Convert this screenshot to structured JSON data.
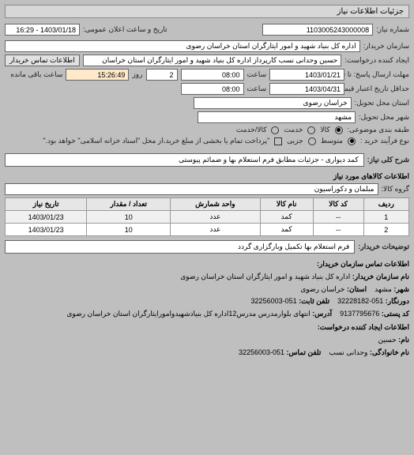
{
  "title": "جزئیات اطلاعات نیاز",
  "header": {
    "need_no_label": "شماره نیاز:",
    "need_no": "1103005243000008",
    "announce_label": "تاریخ و ساعت اعلان عمومی:",
    "announce_date": "1403/01/18 - 16:29",
    "buyer_label": "سازمان خریدار:",
    "buyer": "اداره کل بنیاد شهید و امور ایثارگران استان خراسان رضوی",
    "requester_label": "ایجاد کننده درخواست:",
    "requester": "حسین وحدانی نسب کارپرداز اداره کل بنیاد شهید و امور ایثارگران استان خراسان",
    "contact_btn": "اطلاعات تماس خریدار",
    "deadline_label": "مهلت ارسال پاسخ: تا تاریخ:",
    "deadline_date": "1403/01/21",
    "time_label": "ساعت",
    "deadline_time": "08:00",
    "days_left": "2",
    "days_left_label": "روز",
    "remaining_time": "15:26:49",
    "remaining_label": "ساعت باقی مانده",
    "validity_label": "حداقل تاریخ اعتبار قیمت: تا تاریخ:",
    "validity_date": "1403/04/31",
    "validity_time": "08:00",
    "province_label": "استان محل تحویل:",
    "province": "خراسان رضوی",
    "city_label": "شهر محل تحویل:",
    "city": "مشهد",
    "classify_label": "طبقه بندی موضوعی:",
    "radio_goods": "کالا",
    "radio_service": "خدمت",
    "radio_both": "کالا/خدمت",
    "process_label": "نوع فرآیند خرید :",
    "radio_medium": "متوسط",
    "radio_partial": "جزیی",
    "process_note": "\"پرداخت تمام یا بخشی از مبلغ خرید،از محل \"اسناد خزانه اسلامی\" خواهد بود.\""
  },
  "need_desc": {
    "label": "شرح کلی نیاز:",
    "text": "کمد دیواری - جزئیات مطابق فرم استعلام بها و ضمائم پیوستی"
  },
  "goods": {
    "section_label": "اطلاعات کالاهای مورد نیاز",
    "group_label": "گروه کالا:",
    "group": "مبلمان و دکوراسیون",
    "columns": {
      "row": "ردیف",
      "code": "کد کالا",
      "name": "نام کالا",
      "unit": "واحد شمارش",
      "qty": "تعداد / مقدار",
      "date": "تاریخ نیاز"
    },
    "rows": [
      {
        "row": "1",
        "code": "--",
        "name": "کمد",
        "unit": "عدد",
        "qty": "10",
        "date": "1403/01/23"
      },
      {
        "row": "2",
        "code": "--",
        "name": "کمد",
        "unit": "عدد",
        "qty": "10",
        "date": "1403/01/23"
      }
    ]
  },
  "buyer_notes": {
    "label": "توضیحات خریدار:",
    "text": "فرم استعلام بها تکمیل وبارگزاری گردد"
  },
  "footer": {
    "title": "اطلاعات تماس سازمان خریدار:",
    "org_label": "نام سازمان خریدار:",
    "org": "اداره کل بنیاد شهید و امور ایثارگران استان خراسان رضوی",
    "city_label": "شهر:",
    "city": "مشهد",
    "province_label": "استان:",
    "province": "خراسان رضوی",
    "fax_label": "دورنگار:",
    "fax": "051-32228182",
    "phone_label": "تلفن ثابت:",
    "phone": "051-32256003",
    "postal_label": "کد پستی:",
    "postal": "9137795676",
    "address_label": "آدرس:",
    "address": "انتهای بلوارمدرس مدرس12اداره کل بنیادشهیدوامورایثارگران استان خراسان رضوی",
    "creator_title": "اطلاعات ایجاد کننده درخواست:",
    "name_label": "نام:",
    "name": "حسین",
    "family_label": "نام خانوادگی:",
    "family": "وحدانی نسب",
    "tel_label": "تلفن تماس:",
    "tel": "051-32256003"
  }
}
